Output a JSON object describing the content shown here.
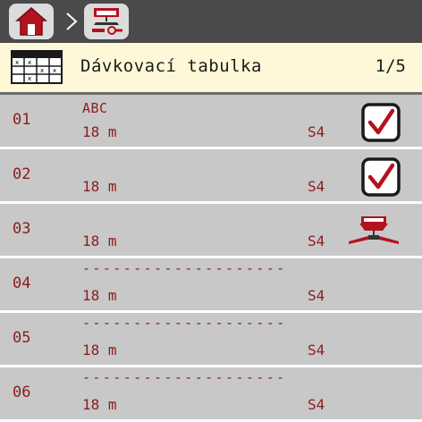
{
  "header": {
    "title": "Dávkovací tabulka",
    "page": "1/5",
    "icon": "table-grid-icon"
  },
  "breadcrumb": {
    "items": [
      "home-icon",
      "spreader-settings-icon"
    ]
  },
  "rows": [
    {
      "num": "01",
      "name": "ABC",
      "width": "18 m",
      "slot": "S4",
      "status": "checked"
    },
    {
      "num": "02",
      "name": "",
      "width": "18 m",
      "slot": "S4",
      "status": "checked"
    },
    {
      "num": "03",
      "name": "",
      "width": "18 m",
      "slot": "S4",
      "status": "active-spreader"
    },
    {
      "num": "04",
      "name": "--------------------",
      "width": "18 m",
      "slot": "S4",
      "status": "empty"
    },
    {
      "num": "05",
      "name": "--------------------",
      "width": "18 m",
      "slot": "S4",
      "status": "empty"
    },
    {
      "num": "06",
      "name": "--------------------",
      "width": "18 m",
      "slot": "S4",
      "status": "empty"
    }
  ],
  "colors": {
    "accent_text": "#8b1c1c",
    "row_bg": "#c8c8c8",
    "header_bg": "#fff8d8",
    "topbar_bg": "#4a4a4a"
  }
}
